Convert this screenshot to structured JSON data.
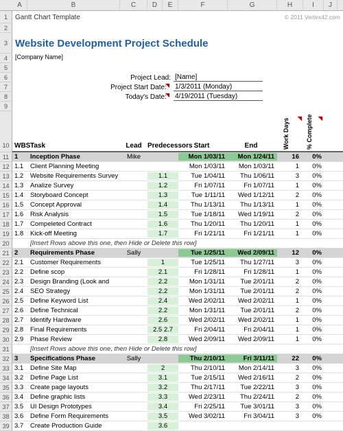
{
  "template_label": "Gantt Chart Template",
  "copyright": "© 2011 Vertex42.com",
  "title": "Website Development Project Schedule",
  "company": "[Company Name]",
  "meta": {
    "lead_label": "Project Lead:",
    "lead_value": "[Name]",
    "start_label": "Project Start Date:",
    "start_value": "1/3/2011 (Monday)",
    "today_label": "Today's Date:",
    "today_value": "4/19/2011 (Tuesday)"
  },
  "cols": {
    "A": "A",
    "B": "B",
    "C": "C",
    "D": "D",
    "E": "E",
    "F": "F",
    "G": "G",
    "H": "H",
    "I": "I",
    "J": "J"
  },
  "headers": {
    "wbs": "WBS",
    "task": "Task",
    "lead": "Lead",
    "pred": "Predecessors",
    "start": "Start",
    "end": "End",
    "workdays": "Work Days",
    "pct": "% Complete"
  },
  "insert_note": "[Insert Rows above this one, then Hide or Delete this row]",
  "rows": [
    {
      "type": "phase",
      "wbs": "1",
      "task": "Inception Phase",
      "lead": "Mike",
      "pred": "",
      "start": "Mon 1/03/11",
      "end": "Mon 1/24/11",
      "wd": "16",
      "pc": "0%"
    },
    {
      "type": "item",
      "wbs": "1.1",
      "task": "Client Planning Meeting",
      "pred": "",
      "start": "Mon 1/03/11",
      "end": "Mon 1/03/11",
      "wd": "1",
      "pc": "0%"
    },
    {
      "type": "item",
      "wbs": "1.2",
      "task": "Website Requirements Survey",
      "pred": "1.1",
      "start": "Tue 1/04/11",
      "end": "Thu 1/06/11",
      "wd": "3",
      "pc": "0%"
    },
    {
      "type": "item",
      "wbs": "1.3",
      "task": "Analize Survey",
      "pred": "1.2",
      "start": "Fri 1/07/11",
      "end": "Fri 1/07/11",
      "wd": "1",
      "pc": "0%"
    },
    {
      "type": "item",
      "wbs": "1.4",
      "task": "Storyboard Concept",
      "pred": "1.3",
      "start": "Tue 1/11/11",
      "end": "Wed 1/12/11",
      "wd": "2",
      "pc": "0%"
    },
    {
      "type": "item",
      "wbs": "1.5",
      "task": "Concept Approval",
      "pred": "1.4",
      "start": "Thu 1/13/11",
      "end": "Thu 1/13/11",
      "wd": "1",
      "pc": "0%"
    },
    {
      "type": "item",
      "wbs": "1.6",
      "task": "Risk Analysis",
      "pred": "1.5",
      "start": "Tue 1/18/11",
      "end": "Wed 1/19/11",
      "wd": "2",
      "pc": "0%"
    },
    {
      "type": "item",
      "wbs": "1.7",
      "task": "Compeleted Contract",
      "pred": "1.6",
      "start": "Thu 1/20/11",
      "end": "Thu 1/20/11",
      "wd": "1",
      "pc": "0%"
    },
    {
      "type": "item",
      "wbs": "1.8",
      "task": "Kick-off Meeting",
      "pred": "1.7",
      "start": "Fri 1/21/11",
      "end": "Fri 1/21/11",
      "wd": "1",
      "pc": "0%"
    },
    {
      "type": "note"
    },
    {
      "type": "phase",
      "wbs": "2",
      "task": "Requirements Phase",
      "lead": "Sally",
      "pred": "",
      "start": "Tue 1/25/11",
      "end": "Wed 2/09/11",
      "wd": "12",
      "pc": "0%"
    },
    {
      "type": "item",
      "wbs": "2.1",
      "task": "Customer Requirements",
      "pred": "1",
      "start": "Tue 1/25/11",
      "end": "Thu 1/27/11",
      "wd": "3",
      "pc": "0%"
    },
    {
      "type": "item",
      "wbs": "2.2",
      "task": "Define scop",
      "pred": "2.1",
      "start": "Fri 1/28/11",
      "end": "Fri 1/28/11",
      "wd": "1",
      "pc": "0%"
    },
    {
      "type": "item",
      "wbs": "2.3",
      "task": "Design Branding (Look and",
      "pred": "2.2",
      "start": "Mon 1/31/11",
      "end": "Tue 2/01/11",
      "wd": "2",
      "pc": "0%"
    },
    {
      "type": "item",
      "wbs": "2.4",
      "task": "SEO Strategy",
      "pred": "2.2",
      "start": "Mon 1/31/11",
      "end": "Tue 2/01/11",
      "wd": "2",
      "pc": "0%"
    },
    {
      "type": "item",
      "wbs": "2.5",
      "task": "Define Keyword List",
      "pred": "2.4",
      "start": "Wed 2/02/11",
      "end": "Wed 2/02/11",
      "wd": "1",
      "pc": "0%"
    },
    {
      "type": "item",
      "wbs": "2.6",
      "task": "Define Technical",
      "pred": "2.2",
      "start": "Mon 1/31/11",
      "end": "Tue 2/01/11",
      "wd": "2",
      "pc": "0%"
    },
    {
      "type": "item",
      "wbs": "2.7",
      "task": "Identify Hardware",
      "pred": "2.6",
      "start": "Wed 2/02/11",
      "end": "Wed 2/02/11",
      "wd": "1",
      "pc": "0%"
    },
    {
      "type": "item",
      "wbs": "2.8",
      "task": "Final Requirements",
      "pred": "2.5    2.7",
      "start": "Fri 2/04/11",
      "end": "Fri 2/04/11",
      "wd": "1",
      "pc": "0%"
    },
    {
      "type": "item",
      "wbs": "2.9",
      "task": "Phase Review",
      "pred": "2.8",
      "start": "Wed 2/09/11",
      "end": "Wed 2/09/11",
      "wd": "1",
      "pc": "0%"
    },
    {
      "type": "note"
    },
    {
      "type": "phase",
      "wbs": "3",
      "task": "Specifications Phase",
      "lead": "Sally",
      "pred": "",
      "start": "Thu 2/10/11",
      "end": "Fri 3/11/11",
      "wd": "22",
      "pc": "0%"
    },
    {
      "type": "item",
      "wbs": "3.1",
      "task": "Define Site Map",
      "pred": "2",
      "start": "Thu 2/10/11",
      "end": "Mon 2/14/11",
      "wd": "3",
      "pc": "0%"
    },
    {
      "type": "item",
      "wbs": "3.2",
      "task": "Define Page List",
      "pred": "3.1",
      "start": "Tue 2/15/11",
      "end": "Wed 2/16/11",
      "wd": "2",
      "pc": "0%"
    },
    {
      "type": "item",
      "wbs": "3.3",
      "task": "Create page layouts",
      "pred": "3.2",
      "start": "Thu 2/17/11",
      "end": "Tue 2/22/11",
      "wd": "3",
      "pc": "0%"
    },
    {
      "type": "item",
      "wbs": "3.4",
      "task": "Define graphic lists",
      "pred": "3.3",
      "start": "Wed 2/23/11",
      "end": "Thu 2/24/11",
      "wd": "2",
      "pc": "0%"
    },
    {
      "type": "item",
      "wbs": "3.5",
      "task": "UI Design Prototypes",
      "pred": "3.4",
      "start": "Fri 2/25/11",
      "end": "Tue 3/01/11",
      "wd": "3",
      "pc": "0%"
    },
    {
      "type": "item",
      "wbs": "3.6",
      "task": "Define Form Requirements",
      "pred": "3.5",
      "start": "Wed 3/02/11",
      "end": "Fri 3/04/11",
      "wd": "3",
      "pc": "0%"
    },
    {
      "type": "item",
      "wbs": "3.7",
      "task": "Create Production Guide",
      "pred": "3.6",
      "start": "",
      "end": "",
      "wd": "",
      "pc": ""
    }
  ]
}
